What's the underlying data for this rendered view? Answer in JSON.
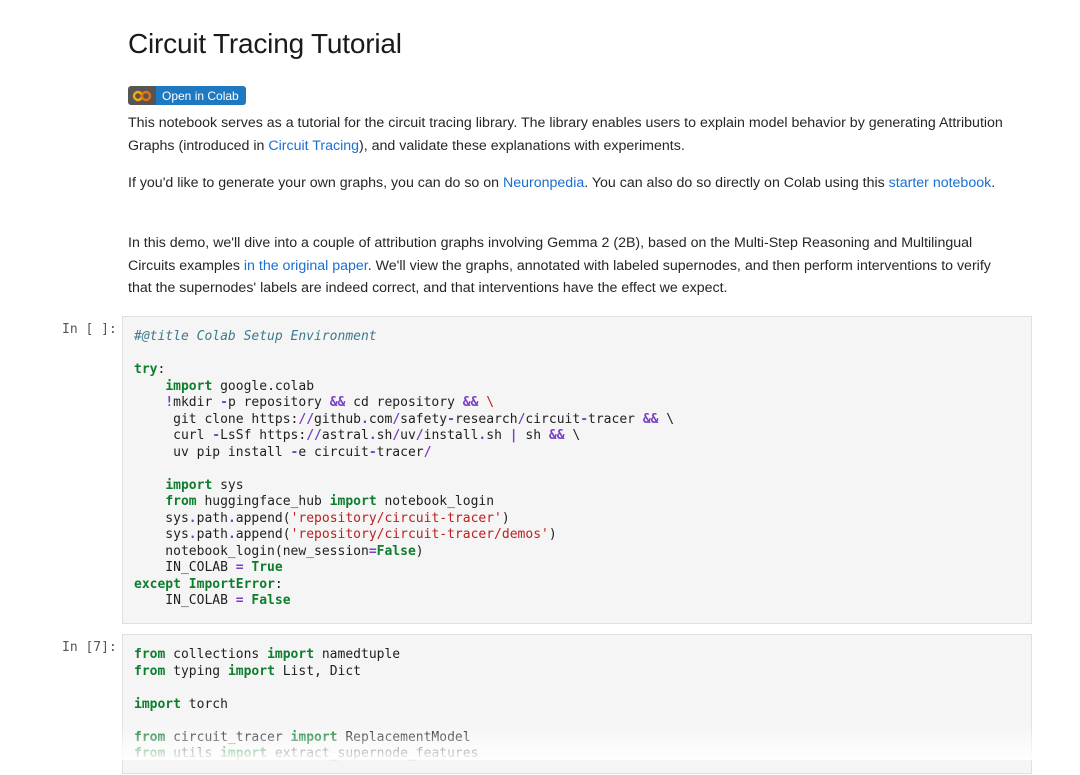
{
  "title": "Circuit Tracing Tutorial",
  "badge": {
    "label": "Open in Colab",
    "logo_text": "CO"
  },
  "paragraphs": {
    "p1": {
      "t1": "This notebook serves as a tutorial for the circuit tracing library. The library enables users to explain model behavior by generating Attribution Graphs (introduced in ",
      "link1": "Circuit Tracing",
      "t2": "), and validate these explanations with experiments."
    },
    "p2": {
      "t1": "If you'd like to generate your own graphs, you can do so on ",
      "link1": "Neuronpedia",
      "t2": ". You can also do so directly on Colab using this ",
      "link2": "starter notebook",
      "t3": "."
    },
    "p3": {
      "t1": "In this demo, we'll dive into a couple of attribution graphs involving Gemma 2 (2B), based on the Multi-Step Reasoning and Multilingual Circuits examples ",
      "link1": "in the original paper",
      "t2": ". We'll view the graphs, annotated with labeled supernodes, and then perform interventions to verify that the supernodes' labels are indeed correct, and that interventions have the effect we expect."
    }
  },
  "cells": [
    {
      "prompt": "In [ ]:",
      "lines": [
        [
          [
            "cm",
            "#@title Colab Setup Environment"
          ]
        ],
        [],
        [
          [
            "k",
            "try"
          ],
          [
            "",
            ":"
          ]
        ],
        [
          [
            "",
            "    "
          ],
          [
            "k",
            "import"
          ],
          [
            "",
            " google.colab"
          ]
        ],
        [
          [
            "",
            "    "
          ],
          [
            "o",
            "!"
          ],
          [
            "",
            "mkdir "
          ],
          [
            "o",
            "-"
          ],
          [
            "",
            "p repository "
          ],
          [
            "o",
            "&&"
          ],
          [
            "",
            " cd repository "
          ],
          [
            "o",
            "&&"
          ],
          [
            "",
            " "
          ],
          [
            "s",
            "\\"
          ]
        ],
        [
          [
            "",
            "     git clone https:"
          ],
          [
            "o",
            "//"
          ],
          [
            "",
            "github"
          ],
          [
            "o",
            "."
          ],
          [
            "",
            "com"
          ],
          [
            "o",
            "/"
          ],
          [
            "",
            "safety"
          ],
          [
            "o",
            "-"
          ],
          [
            "",
            "research"
          ],
          [
            "o",
            "/"
          ],
          [
            "",
            "circuit"
          ],
          [
            "o",
            "-"
          ],
          [
            "",
            "tracer "
          ],
          [
            "o",
            "&&"
          ],
          [
            "",
            " \\"
          ]
        ],
        [
          [
            "",
            "     curl "
          ],
          [
            "o",
            "-"
          ],
          [
            "",
            "LsSf https:"
          ],
          [
            "o",
            "//"
          ],
          [
            "",
            "astral"
          ],
          [
            "o",
            "."
          ],
          [
            "",
            "sh"
          ],
          [
            "o",
            "/"
          ],
          [
            "",
            "uv"
          ],
          [
            "o",
            "/"
          ],
          [
            "",
            "install"
          ],
          [
            "o",
            "."
          ],
          [
            "",
            "sh "
          ],
          [
            "o",
            "|"
          ],
          [
            "",
            " sh "
          ],
          [
            "o",
            "&&"
          ],
          [
            "",
            " \\"
          ]
        ],
        [
          [
            "",
            "     uv pip install "
          ],
          [
            "o",
            "-"
          ],
          [
            "",
            "e circuit"
          ],
          [
            "o",
            "-"
          ],
          [
            "",
            "tracer"
          ],
          [
            "o",
            "/"
          ]
        ],
        [],
        [
          [
            "",
            "    "
          ],
          [
            "k",
            "import"
          ],
          [
            "",
            " sys"
          ]
        ],
        [
          [
            "",
            "    "
          ],
          [
            "k",
            "from"
          ],
          [
            "",
            " huggingface_hub "
          ],
          [
            "k",
            "import"
          ],
          [
            "",
            " notebook_login"
          ]
        ],
        [
          [
            "",
            "    sys"
          ],
          [
            "o",
            "."
          ],
          [
            "",
            "path"
          ],
          [
            "o",
            "."
          ],
          [
            "",
            "append("
          ],
          [
            "s",
            "'repository/circuit-tracer'"
          ],
          [
            "",
            ")"
          ]
        ],
        [
          [
            "",
            "    sys"
          ],
          [
            "o",
            "."
          ],
          [
            "",
            "path"
          ],
          [
            "o",
            "."
          ],
          [
            "",
            "append("
          ],
          [
            "s",
            "'repository/circuit-tracer/demos'"
          ],
          [
            "",
            ")"
          ]
        ],
        [
          [
            "",
            "    notebook_login(new_session"
          ],
          [
            "o",
            "="
          ],
          [
            "k",
            "False"
          ],
          [
            "",
            ")"
          ]
        ],
        [
          [
            "",
            "    IN_COLAB "
          ],
          [
            "o",
            "="
          ],
          [
            "",
            " "
          ],
          [
            "k",
            "True"
          ]
        ],
        [
          [
            "k",
            "except"
          ],
          [
            "",
            " "
          ],
          [
            "k",
            "ImportError"
          ],
          [
            "",
            ":"
          ]
        ],
        [
          [
            "",
            "    IN_COLAB "
          ],
          [
            "o",
            "="
          ],
          [
            "",
            " "
          ],
          [
            "k",
            "False"
          ]
        ]
      ]
    },
    {
      "prompt": "In [7]:",
      "lines": [
        [
          [
            "k",
            "from"
          ],
          [
            "",
            " collections "
          ],
          [
            "k",
            "import"
          ],
          [
            "",
            " namedtuple"
          ]
        ],
        [
          [
            "k",
            "from"
          ],
          [
            "",
            " typing "
          ],
          [
            "k",
            "import"
          ],
          [
            "",
            " List, Dict"
          ]
        ],
        [],
        [
          [
            "k",
            "import"
          ],
          [
            "",
            " torch"
          ]
        ],
        [],
        [
          [
            "k",
            "from"
          ],
          [
            "",
            " circuit_tracer "
          ],
          [
            "k",
            "import"
          ],
          [
            "",
            " ReplacementModel"
          ]
        ],
        [
          [
            "k",
            "from"
          ],
          [
            "",
            " utils "
          ],
          [
            "k",
            "import"
          ],
          [
            "",
            " extract_supernode_features"
          ]
        ]
      ]
    }
  ]
}
